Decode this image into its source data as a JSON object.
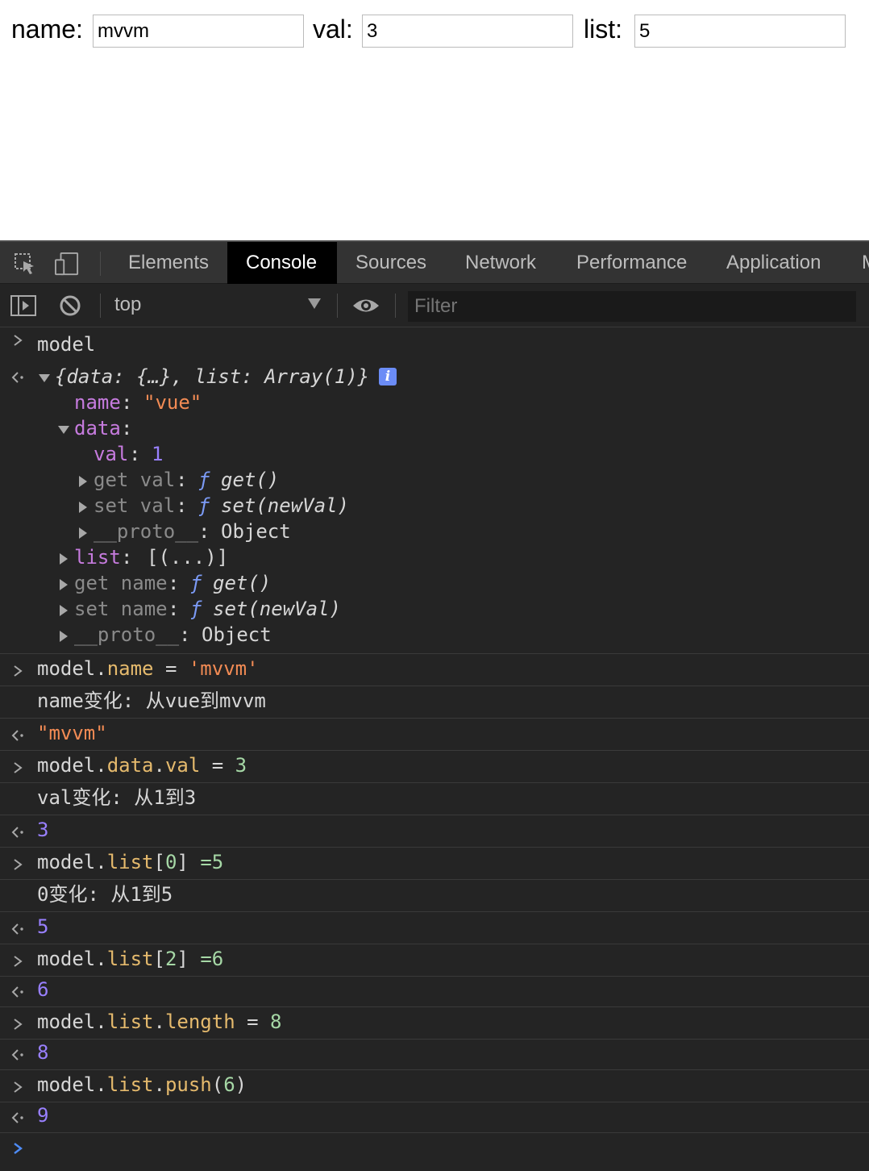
{
  "page": {
    "fields": [
      {
        "label": "name:",
        "value": "mvvm"
      },
      {
        "label": "val:",
        "value": "3"
      },
      {
        "label": "list:",
        "value": "5"
      }
    ]
  },
  "devtools": {
    "tabs": [
      "Elements",
      "Console",
      "Sources",
      "Network",
      "Performance",
      "Application",
      "M"
    ],
    "active_tab": "Console",
    "icons": [
      "inspect-element-icon",
      "device-toolbar-icon",
      "sidebar-toggle-icon",
      "clear-console-icon",
      "eye-icon"
    ],
    "context": "top",
    "filter_placeholder": "Filter"
  },
  "console": {
    "model_cmd": "model",
    "object_summary": "{data: {…}, list: Array(1)}",
    "info_badge": "i",
    "tree": {
      "name_key": "name",
      "name_value": "\"vue\"",
      "data_key": "data",
      "val_key": "val",
      "val_value": "1",
      "get_val": "get val",
      "get_fn": "get()",
      "set_val": "set val",
      "set_fn": "set(newVal)",
      "proto_key": "__proto__",
      "proto_value": "Object",
      "list_key": "list",
      "list_value": "[(...)]",
      "get_name": "get name",
      "set_name": "set name",
      "f_symbol": "ƒ"
    },
    "entries": [
      {
        "type": "input",
        "parts": [
          "model.",
          "name",
          " = ",
          "'mvvm'"
        ]
      },
      {
        "type": "log",
        "text": "name变化: 从vue到mvvm"
      },
      {
        "type": "result",
        "text": "\"mvvm\""
      },
      {
        "type": "input",
        "parts": [
          "model.",
          "data",
          ".",
          "val",
          " = ",
          "3"
        ]
      },
      {
        "type": "log",
        "text": "val变化: 从1到3"
      },
      {
        "type": "result",
        "text": "3"
      },
      {
        "type": "input",
        "parts": [
          "model.",
          "list",
          "[",
          "0",
          "] ",
          "=5"
        ]
      },
      {
        "type": "log",
        "text": "0变化: 从1到5"
      },
      {
        "type": "result",
        "text": "5"
      },
      {
        "type": "input",
        "parts": [
          "model.",
          "list",
          "[",
          "2",
          "] ",
          "=6"
        ]
      },
      {
        "type": "result",
        "text": "6"
      },
      {
        "type": "input",
        "parts": [
          "model.",
          "list",
          ".",
          "length",
          " = ",
          "8"
        ]
      },
      {
        "type": "result",
        "text": "8"
      },
      {
        "type": "input",
        "parts": [
          "model.",
          "list",
          ".",
          "push",
          "(",
          "6",
          ")"
        ]
      },
      {
        "type": "result",
        "text": "9"
      }
    ]
  },
  "colors": {
    "devtools_bg": "#242424",
    "tab_bg": "#333333",
    "active_tab_bg": "#000000",
    "purple_key": "#c67bde",
    "string": "#f28b54",
    "number": "#9980ff",
    "function": "#7c9bf6",
    "property": "#e5ba6d",
    "prompt_blue": "#4e8bf5"
  }
}
